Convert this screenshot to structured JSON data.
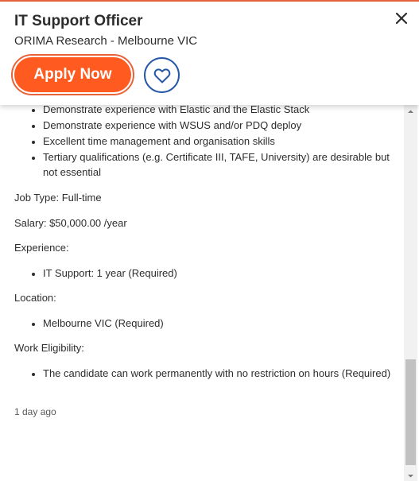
{
  "header": {
    "title": "IT Support Officer",
    "company_location": "ORIMA Research - Melbourne VIC",
    "apply_label": "Apply Now",
    "icons": {
      "close": "close-icon",
      "save": "heart-icon"
    },
    "colors": {
      "apply_bg": "#ff5a1f",
      "apply_ring": "#e8623b",
      "save_ring": "#2557a7"
    }
  },
  "requirements": [
    "Demonstrate experience with Elastic and the Elastic Stack",
    "Demonstrate experience with WSUS and/or PDQ deploy",
    "Excellent time management and organisation skills",
    "Tertiary qualifications (e.g. Certificate III, TAFE, University) are desirable but not essential"
  ],
  "job_type": "Job Type: Full-time",
  "salary": "Salary: $50,000.00 /year",
  "experience": {
    "label": "Experience:",
    "items": [
      "IT Support: 1 year (Required)"
    ]
  },
  "location": {
    "label": "Location:",
    "items": [
      "Melbourne VIC (Required)"
    ]
  },
  "work_eligibility": {
    "label": "Work Eligibility:",
    "items": [
      "The candidate can work permanently with no restriction on hours (Required)"
    ]
  },
  "posted": "1 day ago"
}
